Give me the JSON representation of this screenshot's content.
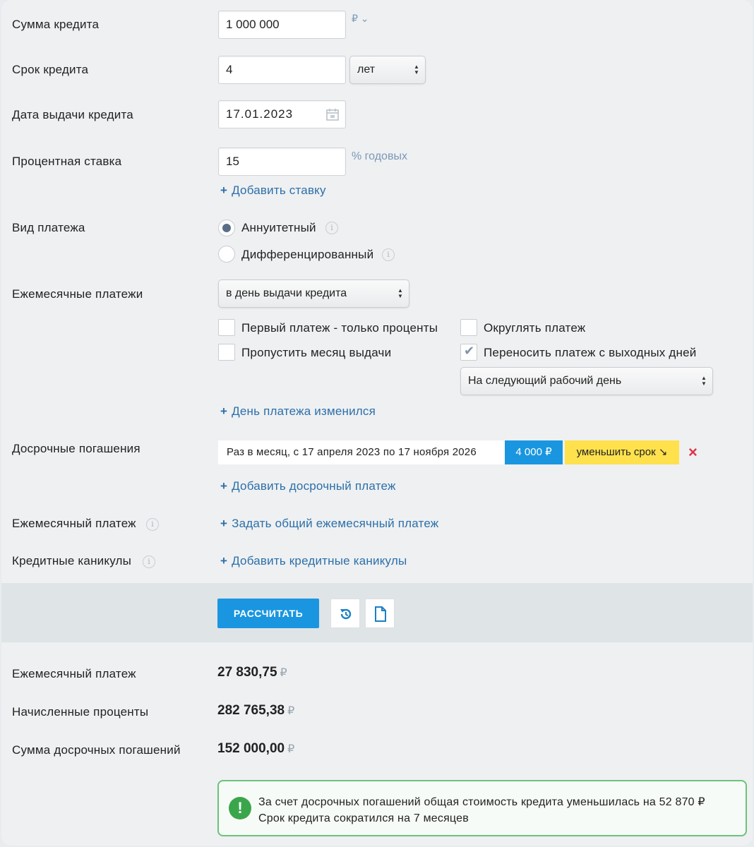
{
  "fields": {
    "amount_label": "Сумма кредита",
    "amount_value": "1 000 000",
    "amount_currency": "₽ ⌄",
    "term_label": "Срок кредита",
    "term_value": "4",
    "term_unit": "лет",
    "date_label": "Дата выдачи кредита",
    "date_value": "17.01.2023",
    "rate_label": "Процентная ставка",
    "rate_value": "15",
    "rate_unit": "% годовых",
    "add_rate": "Добавить ставку",
    "payment_type_label": "Вид платежа",
    "payment_type_options": [
      {
        "label": "Аннуитетный",
        "selected": true
      },
      {
        "label": "Дифференцированный",
        "selected": false
      }
    ],
    "monthly_label": "Ежемесячные платежи",
    "monthly_select": "в день выдачи кредита",
    "checkboxes": [
      {
        "label": "Первый платеж - только проценты",
        "checked": false
      },
      {
        "label": "Пропустить месяц выдачи",
        "checked": false
      },
      {
        "label": "Округлять платеж",
        "checked": false
      },
      {
        "label": "Переносить платеж с выходных дней",
        "checked": true
      }
    ],
    "weekend_select": "На следующий рабочий день",
    "payment_day_changed": "День платежа изменился",
    "early_label": "Досрочные погашения",
    "early_item": {
      "desc": "Раз в месяц, с 17 апреля 2023 по 17 ноября 2026",
      "amount": "4 000 ₽",
      "mode": "уменьшить срок ↘",
      "remove": "×"
    },
    "add_early": "Добавить досрочный платеж",
    "monthly_payment_label": "Ежемесячный платеж",
    "set_monthly": "Задать общий ежемесячный платеж",
    "holidays_label": "Кредитные каникулы",
    "add_holidays": "Добавить кредитные каникулы"
  },
  "actions": {
    "calc": "РАССЧИТАТЬ"
  },
  "results": {
    "monthly_label": "Ежемесячный платеж",
    "monthly_value": "27 830,75",
    "interest_label": "Начисленные проценты",
    "interest_value": "282 765,38",
    "early_sum_label": "Сумма досрочных погашений",
    "early_sum_value": "152 000,00",
    "currency": "₽",
    "alert_icon": "!",
    "alert_text": "За счет досрочных погашений общая стоимость кредита уменьшилась на 52 870 ₽ Срок кредита сократился на 7 месяцев"
  },
  "colors": {
    "accent": "#1a96e0",
    "link": "#2d6fa8",
    "badge_yellow": "#ffe14d",
    "success": "#3aa64b",
    "danger": "#e0304a"
  }
}
